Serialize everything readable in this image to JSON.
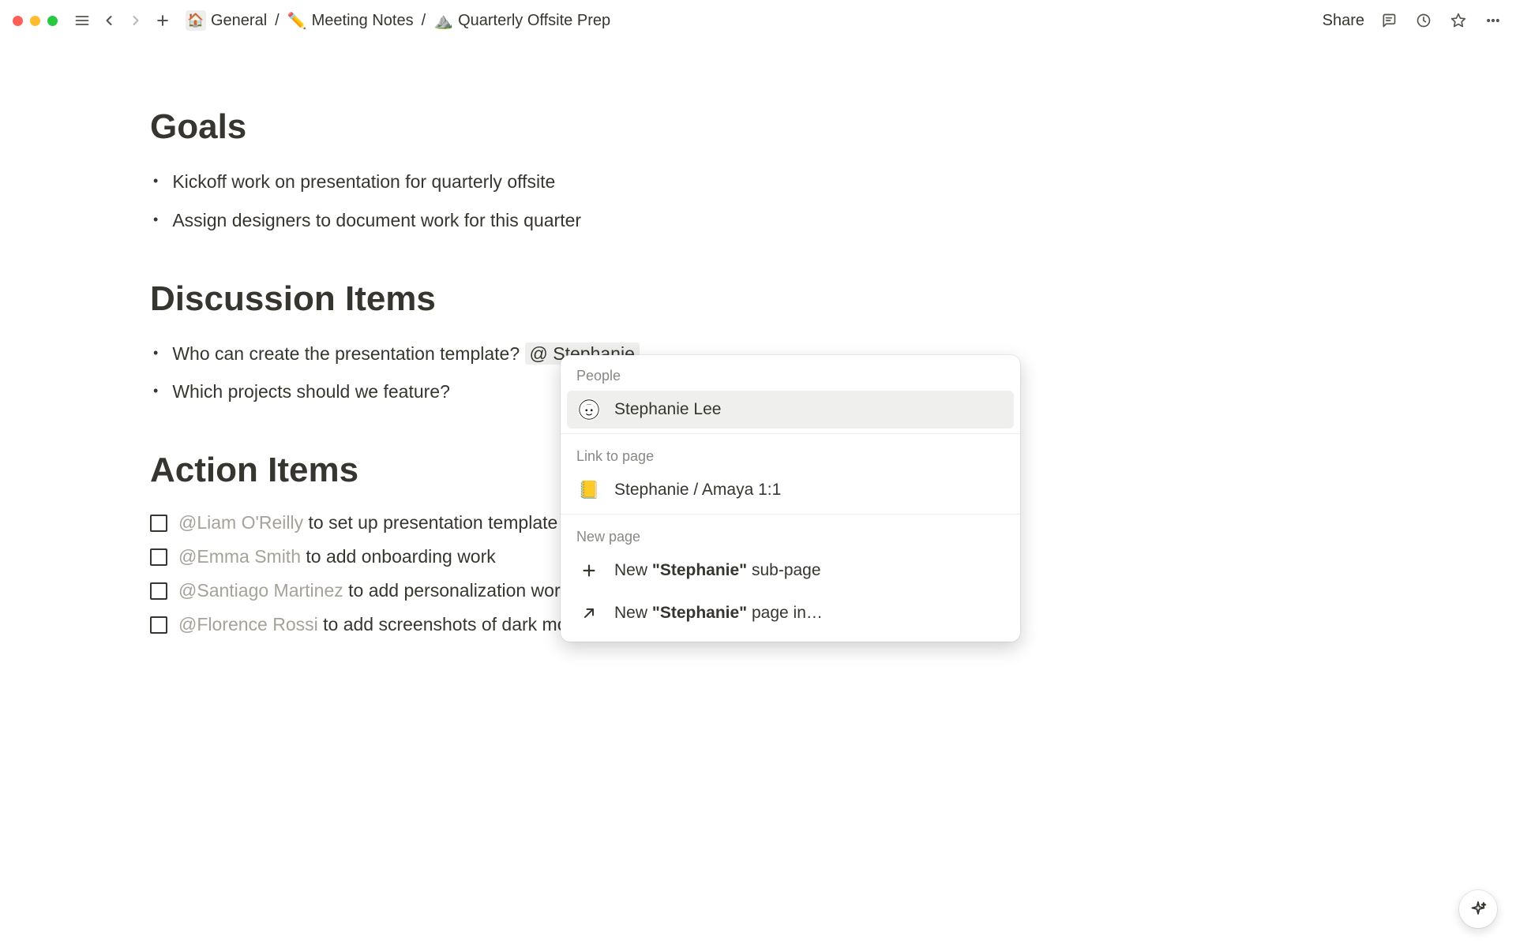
{
  "toolbar": {
    "breadcrumb": [
      {
        "icon": "🏠",
        "label": "General"
      },
      {
        "icon": "✏️",
        "label": "Meeting Notes"
      },
      {
        "icon": "⛰️",
        "label": "Quarterly Offsite Prep"
      }
    ],
    "share_label": "Share"
  },
  "sections": {
    "goals": {
      "heading": "Goals",
      "items": [
        "Kickoff work on presentation for quarterly offsite",
        "Assign designers to document work for this quarter"
      ]
    },
    "discussion": {
      "heading": "Discussion Items",
      "items": [
        {
          "text": "Who can create the presentation template?",
          "mention": "@ Stephanie"
        },
        {
          "text": "Which projects should we feature?"
        }
      ]
    },
    "actions": {
      "heading": "Action Items",
      "items": [
        {
          "assignee": "@Liam O'Reilly",
          "text": " to set up presentation template"
        },
        {
          "assignee": "@Emma Smith",
          "text": " to add onboarding work"
        },
        {
          "assignee": "@Santiago Martinez",
          "text": " to add personalization work"
        },
        {
          "assignee": "@Florence Rossi",
          "text": " to add screenshots of dark mode"
        }
      ]
    }
  },
  "popup": {
    "people_label": "People",
    "people": [
      {
        "name": "Stephanie Lee"
      }
    ],
    "link_label": "Link to page",
    "links": [
      {
        "icon": "📒",
        "label": "Stephanie / Amaya 1:1"
      }
    ],
    "newpage_label": "New page",
    "new_sub_prefix": "New ",
    "new_sub_quoted": "\"Stephanie\"",
    "new_sub_suffix": " sub-page",
    "new_in_prefix": "New ",
    "new_in_quoted": "\"Stephanie\"",
    "new_in_suffix": " page in…"
  }
}
